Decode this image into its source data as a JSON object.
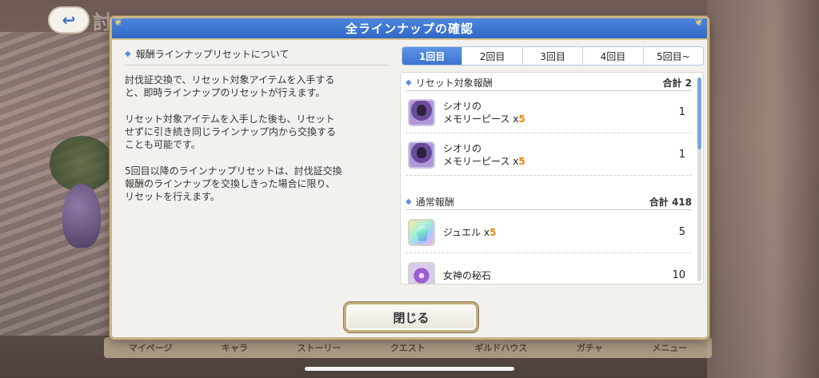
{
  "background": {
    "title_partial": "討",
    "bottom_nav": [
      "マイページ",
      "キャラ",
      "ストーリー",
      "クエスト",
      "ギルドハウス",
      "ガチャ",
      "メニュー"
    ]
  },
  "dialog": {
    "title": "全ラインナップの確認",
    "section_title": "報酬ラインナップリセットについて",
    "paragraphs": [
      "討伐証交換で、リセット対象アイテムを入手する\nと、即時ラインナップのリセットが行えます。",
      "リセット対象アイテムを入手した後も、リセット\nせずに引き続き同じラインナップ内から交換する\nことも可能です。",
      "5回目以降のラインナップリセットは、討伐証交換\n報酬のラインナップを交換しきった場合に限り、\nリセットを行えます。"
    ],
    "tabs": [
      {
        "label": "1回目",
        "active": true
      },
      {
        "label": "2回目",
        "active": false
      },
      {
        "label": "3回目",
        "active": false
      },
      {
        "label": "4回目",
        "active": false
      },
      {
        "label": "5回目~",
        "active": false
      }
    ],
    "groups": {
      "reset": {
        "title": "リセット対象報酬",
        "total": "合計 2",
        "items": [
          {
            "name_line1": "シオリの",
            "name_line2": "メモリーピース",
            "mult": " x",
            "qty": "5",
            "count": "1",
            "icon": "memory-piece-icon"
          },
          {
            "name_line1": "シオリの",
            "name_line2": "メモリーピース",
            "mult": " x",
            "qty": "5",
            "count": "1",
            "icon": "memory-piece-icon"
          }
        ]
      },
      "normal": {
        "title": "通常報酬",
        "total": "合計 418",
        "items": [
          {
            "name": "ジュエル",
            "mult": " x",
            "qty": "5",
            "count": "5",
            "icon": "jewel-icon"
          },
          {
            "name": "女神の秘石",
            "count": "10",
            "icon": "goddess-stone-icon"
          }
        ]
      }
    },
    "close_label": "閉じる"
  },
  "colors": {
    "header_blue": "#3c74cf",
    "qty_orange": "#e58a00",
    "gold_border": "#c9b489"
  }
}
